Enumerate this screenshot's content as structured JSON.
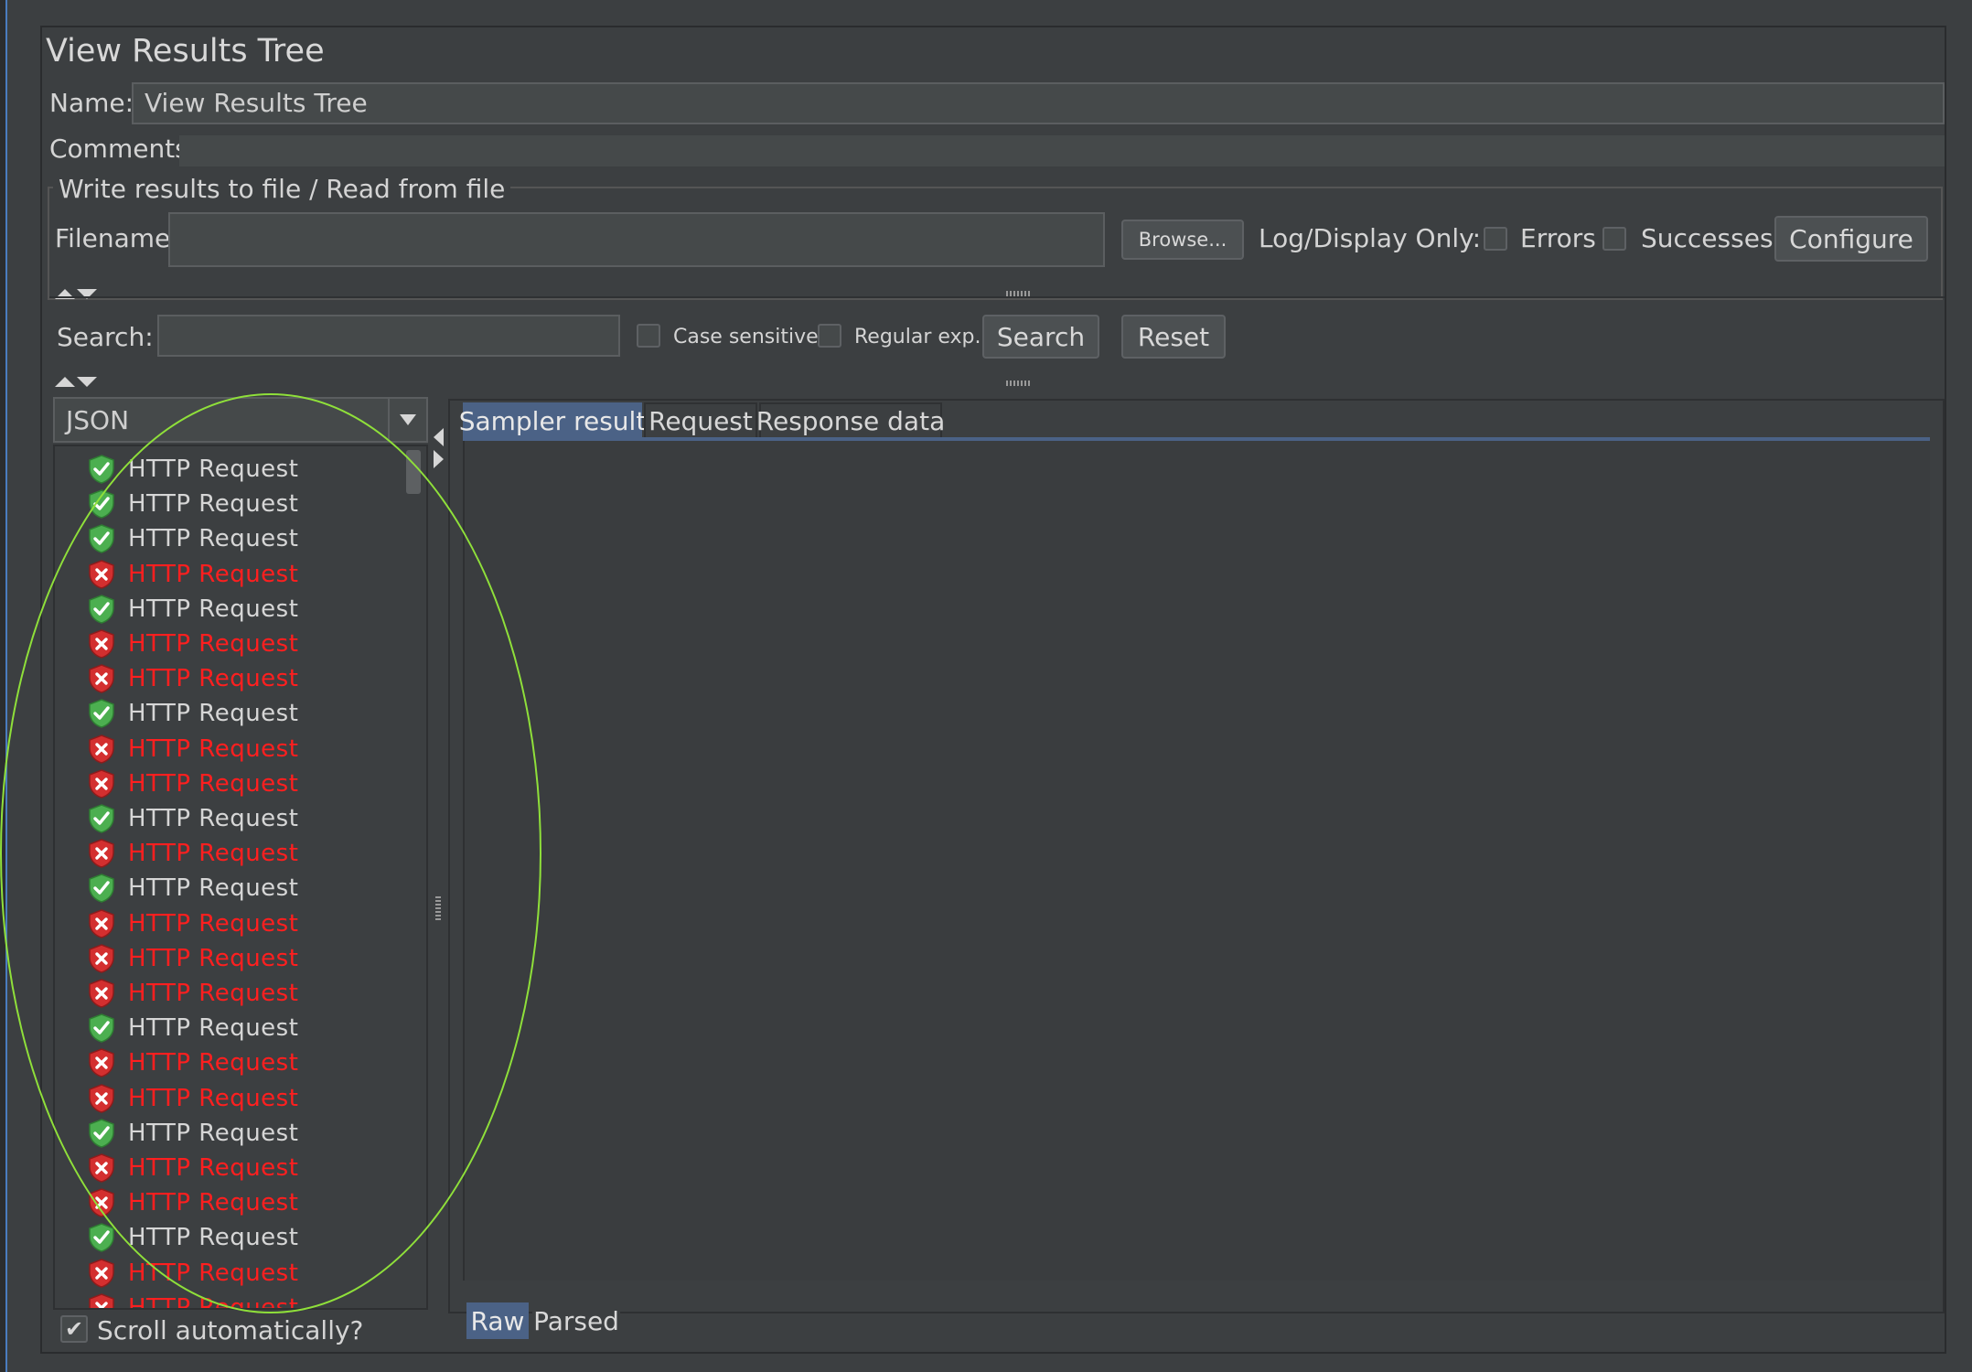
{
  "window": {
    "title": "View Results Tree"
  },
  "name_row": {
    "label": "Name:",
    "value": "View Results Tree"
  },
  "comments_row": {
    "label": "Comments:",
    "value": ""
  },
  "file_group": {
    "legend": "Write results to file / Read from file",
    "filename_label": "Filename",
    "filename_value": "",
    "browse_label": "Browse...",
    "log_display_label": "Log/Display Only:",
    "errors_label": "Errors",
    "errors_checked": false,
    "successes_label": "Successes",
    "successes_checked": false,
    "configure_label": "Configure"
  },
  "search_bar": {
    "label": "Search:",
    "value": "",
    "case_sensitive_label": "Case sensitive",
    "case_sensitive_checked": false,
    "regex_label": "Regular exp.",
    "regex_checked": false,
    "search_button": "Search",
    "reset_button": "Reset"
  },
  "renderer_select": {
    "selected": "JSON"
  },
  "tree": {
    "items": [
      {
        "label": "HTTP Request",
        "status": "success"
      },
      {
        "label": "HTTP Request",
        "status": "success"
      },
      {
        "label": "HTTP Request",
        "status": "success"
      },
      {
        "label": "HTTP Request",
        "status": "error"
      },
      {
        "label": "HTTP Request",
        "status": "success"
      },
      {
        "label": "HTTP Request",
        "status": "error"
      },
      {
        "label": "HTTP Request",
        "status": "error"
      },
      {
        "label": "HTTP Request",
        "status": "success"
      },
      {
        "label": "HTTP Request",
        "status": "error"
      },
      {
        "label": "HTTP Request",
        "status": "error"
      },
      {
        "label": "HTTP Request",
        "status": "success"
      },
      {
        "label": "HTTP Request",
        "status": "error"
      },
      {
        "label": "HTTP Request",
        "status": "success"
      },
      {
        "label": "HTTP Request",
        "status": "error"
      },
      {
        "label": "HTTP Request",
        "status": "error"
      },
      {
        "label": "HTTP Request",
        "status": "error"
      },
      {
        "label": "HTTP Request",
        "status": "success"
      },
      {
        "label": "HTTP Request",
        "status": "error"
      },
      {
        "label": "HTTP Request",
        "status": "error"
      },
      {
        "label": "HTTP Request",
        "status": "success"
      },
      {
        "label": "HTTP Request",
        "status": "error"
      },
      {
        "label": "HTTP Request",
        "status": "error"
      },
      {
        "label": "HTTP Request",
        "status": "success"
      },
      {
        "label": "HTTP Request",
        "status": "error"
      },
      {
        "label": "HTTP Request",
        "status": "error"
      }
    ]
  },
  "scroll_auto": {
    "label": "Scroll automatically?",
    "checked": true
  },
  "result_tabs": {
    "tabs": [
      "Sampler result",
      "Request",
      "Response data"
    ],
    "selected": "Sampler result"
  },
  "view_tabs": {
    "tabs": [
      "Raw",
      "Parsed"
    ],
    "selected": "Raw"
  },
  "colors": {
    "background": "#3c3f41",
    "success_icon": "#4caf50",
    "error_icon": "#d32f2f",
    "error_text": "#ff1f1f",
    "selected_tab": "#4b6286",
    "annotation": "#8fe03a"
  },
  "icons": {
    "success": "shield-check-icon",
    "error": "shield-x-icon"
  }
}
